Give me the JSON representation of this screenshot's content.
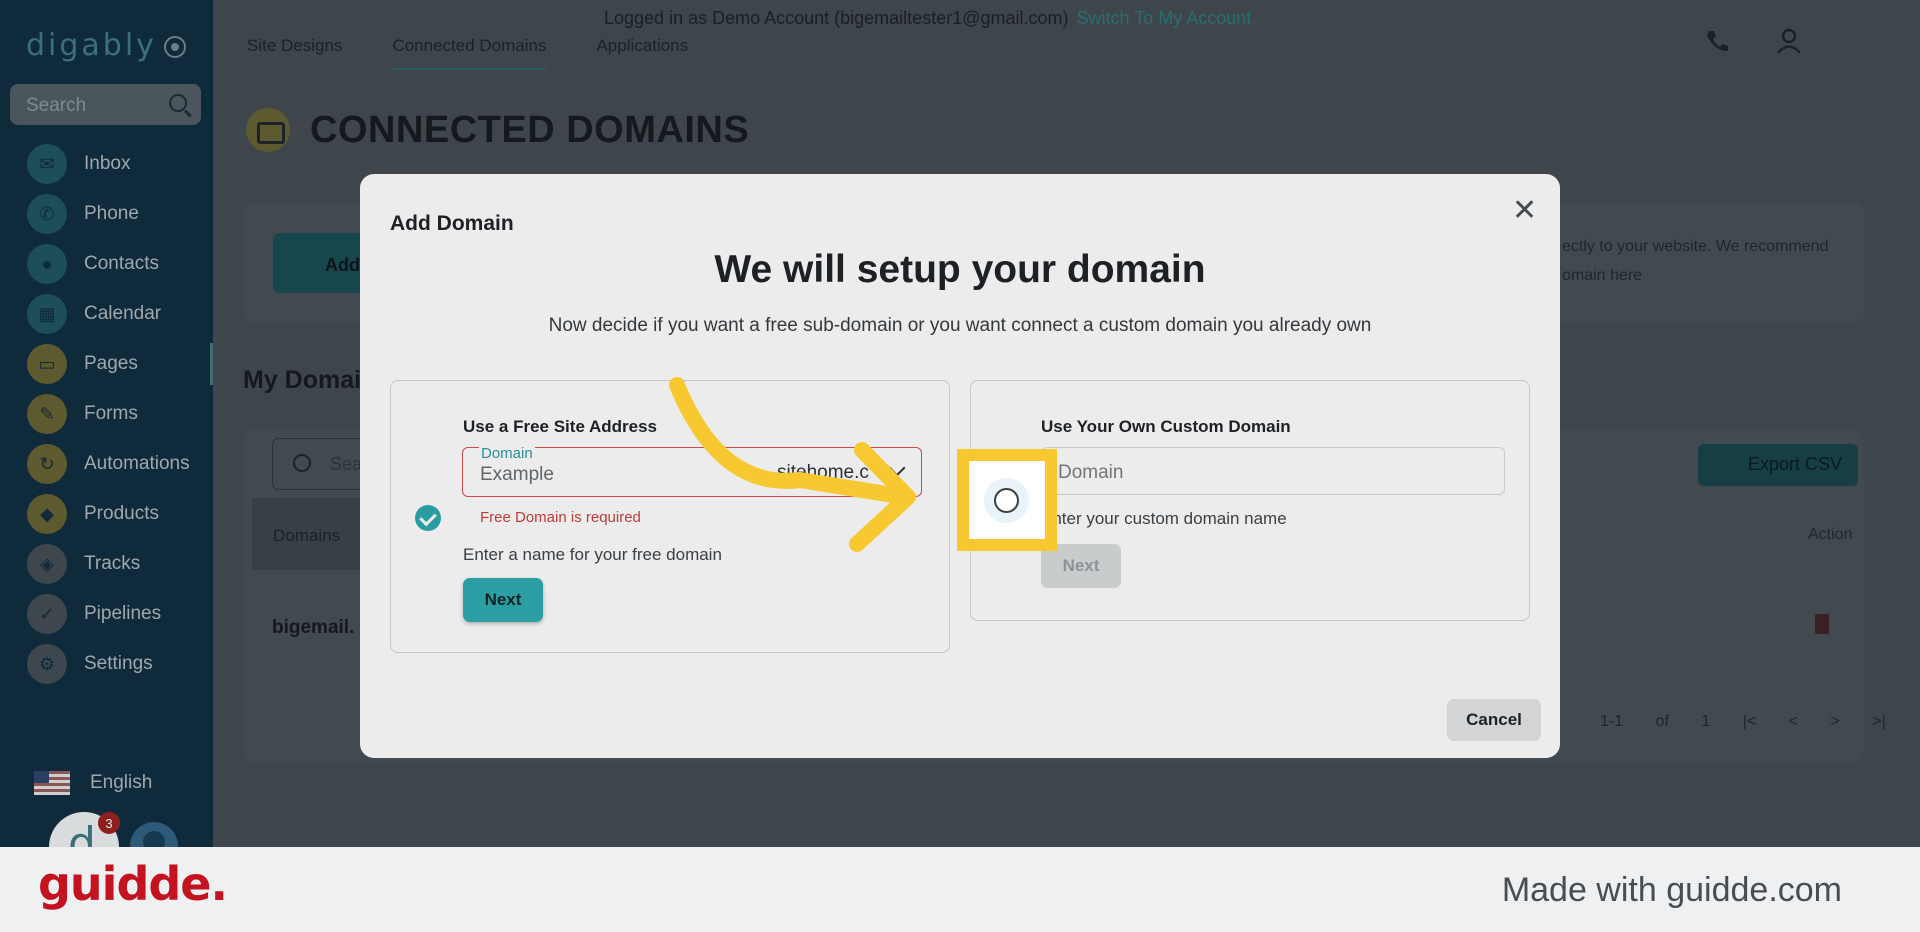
{
  "sidebar": {
    "logo": "digably",
    "search_placeholder": "Search",
    "items": [
      {
        "label": "Inbox",
        "icon": "chat-icon",
        "color": "#1e4e58"
      },
      {
        "label": "Phone",
        "icon": "phone-icon",
        "color": "#1e4e58"
      },
      {
        "label": "Contacts",
        "icon": "contacts-icon",
        "color": "#1e4e58"
      },
      {
        "label": "Calendar",
        "icon": "calendar-icon",
        "color": "#1e4e58"
      },
      {
        "label": "Pages",
        "icon": "pages-icon",
        "color": "#5c5a2e"
      },
      {
        "label": "Forms",
        "icon": "pencil-icon",
        "color": "#5c5a2e"
      },
      {
        "label": "Automations",
        "icon": "refresh-icon",
        "color": "#5c5a2e"
      },
      {
        "label": "Products",
        "icon": "tag-icon",
        "color": "#5c5a2e"
      },
      {
        "label": "Tracks",
        "icon": "route-icon",
        "color": "#3e474d"
      },
      {
        "label": "Pipelines",
        "icon": "check-circle-icon",
        "color": "#3e474d"
      },
      {
        "label": "Settings",
        "icon": "gear-icon",
        "color": "#3e474d"
      }
    ],
    "language": "English",
    "notification_count": "3"
  },
  "topbar": {
    "notice": "Logged in as Demo Account (bigemailtester1@gmail.com)",
    "switch_link": "Switch To My Account"
  },
  "tabs": [
    "Site Designs",
    "Connected Domains",
    "Applications"
  ],
  "page": {
    "title": "CONNECTED DOMAINS",
    "add_button": "Add",
    "desc_line1": "ectly to your website. We recommend",
    "desc_line2": "omain here",
    "section_title": "My Domai",
    "search_placeholder": "Sea",
    "column_domains": "Domains",
    "column_action": "Action",
    "row_domain": "bigemail.",
    "export_button": "Export CSV",
    "pagination": "1-1 of 1 |< < > >|"
  },
  "modal": {
    "title": "Add Domain",
    "heading": "We will setup your domain",
    "subtitle": "Now decide if you want a free sub-domain or you want connect a custom domain you already own",
    "free": {
      "label": "Use a Free Site Address",
      "field_label": "Domain",
      "field_value": "Example",
      "suffix": "sitehome.c",
      "error": "Free Domain is required",
      "help": "Enter a name for your free domain",
      "next": "Next"
    },
    "custom": {
      "label": "Use Your Own Custom Domain",
      "placeholder": "Domain",
      "help": "Enter your custom domain name",
      "next": "Next"
    },
    "cancel": "Cancel"
  },
  "footer": {
    "logo": "guidde.",
    "made_with": "Made with guidde.com"
  },
  "colors": {
    "accent": "#2b9ea4",
    "highlight": "#f7c82f",
    "error": "#c23b3b",
    "brand_red": "#c4121f"
  }
}
